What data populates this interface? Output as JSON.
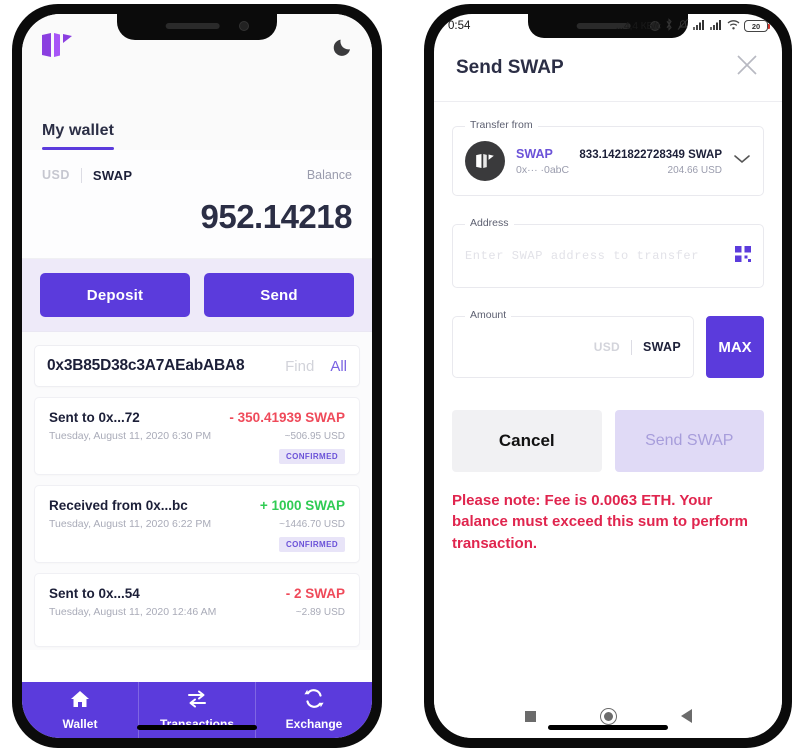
{
  "wallet": {
    "logo_icon": "swap-logo-icon",
    "theme_toggle_icon": "moon-icon",
    "tab_label": "My wallet",
    "balance": {
      "currency_usd": "USD",
      "currency_swap": "SWAP",
      "balance_label": "Balance",
      "amount": "952.14218"
    },
    "actions": {
      "deposit_label": "Deposit",
      "send_label": "Send"
    },
    "search": {
      "value": "0x3B85D38c3A7AEabABA8",
      "find_label": "Find",
      "all_label": "All"
    },
    "transactions": [
      {
        "title": "Sent to 0x...72",
        "date": "Tuesday, August 11, 2020 6:30 PM",
        "amount": "- 350.41939 SWAP",
        "usd": "~506.95 USD",
        "status": "CONFIRMED",
        "direction": "out"
      },
      {
        "title": "Received from 0x...bc",
        "date": "Tuesday, August 11, 2020 6:22 PM",
        "amount": "+ 1000 SWAP",
        "usd": "~1446.70 USD",
        "status": "CONFIRMED",
        "direction": "in"
      },
      {
        "title": "Sent to 0x...54",
        "date": "Tuesday, August 11, 2020 12:46 AM",
        "amount": "- 2 SWAP",
        "usd": "~2.89 USD",
        "status": "",
        "direction": "out"
      }
    ],
    "bottom_nav": [
      {
        "label": "Wallet",
        "icon": "home-icon"
      },
      {
        "label": "Transactions",
        "icon": "transfer-arrows-icon"
      },
      {
        "label": "Exchange",
        "icon": "refresh-cycle-icon"
      }
    ]
  },
  "send": {
    "statusbar": {
      "time": "0:54",
      "network_speed": "...4,4 КБ/c",
      "icons": [
        "bluetooth-icon",
        "mute-bell-icon",
        "signal-bars-icon",
        "signal-bars-icon",
        "wifi-icon"
      ],
      "battery_level": "20"
    },
    "header": {
      "title": "Send SWAP",
      "close_icon": "close-icon"
    },
    "transfer_from": {
      "legend": "Transfer from",
      "avatar_icon": "swap-logo-icon",
      "symbol": "SWAP",
      "address": "0x··· ·0abC",
      "amount": "833.1421822728349 SWAP",
      "usd": "204.66 USD",
      "chevron_icon": "chevron-down-icon"
    },
    "address_field": {
      "legend": "Address",
      "placeholder": "Enter SWAP address to transfer",
      "value": "",
      "qr_icon": "qr-code-icon"
    },
    "amount_field": {
      "legend": "Amount",
      "value": "",
      "currency_usd": "USD",
      "currency_swap": "SWAP",
      "max_label": "MAX"
    },
    "cta": {
      "cancel_label": "Cancel",
      "send_label": "Send SWAP"
    },
    "note": "Please note: Fee is 0.0063 ETH. Your balance must exceed this sum to perform transaction.",
    "android_nav": [
      "recents-square-icon",
      "home-circle-icon",
      "back-triangle-icon"
    ]
  },
  "colors": {
    "accent": "#5b3bdc",
    "accent_light": "#e0daf6",
    "positive": "#2fcb53",
    "negative": "#ef4a5a",
    "warning": "#e0254e",
    "dark_text": "#2b2e45"
  }
}
